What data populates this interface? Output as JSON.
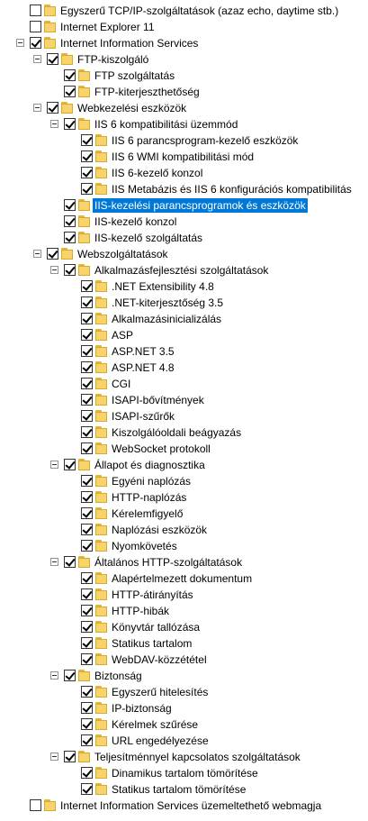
{
  "tree": {
    "items": [
      {
        "label": "Egyszerű TCP/IP-szolgáltatások (azaz echo, daytime stb.)",
        "level": 0,
        "checked": false,
        "expander": false
      },
      {
        "label": "Internet Explorer 11",
        "level": 0,
        "checked": false,
        "expander": false
      },
      {
        "label": "Internet Information Services",
        "level": 0,
        "checked": true,
        "expander": true
      },
      {
        "label": "FTP-kiszolgáló",
        "level": 1,
        "checked": true,
        "expander": true
      },
      {
        "label": "FTP szolgáltatás",
        "level": 2,
        "checked": true,
        "expander": false
      },
      {
        "label": "FTP-kiterjeszthetőség",
        "level": 2,
        "checked": true,
        "expander": false
      },
      {
        "label": "Webkezelési eszközök",
        "level": 1,
        "checked": true,
        "expander": true
      },
      {
        "label": "IIS 6 kompatibilitási üzemmód",
        "level": 2,
        "checked": true,
        "expander": true
      },
      {
        "label": "IIS 6 parancsprogram-kezelő eszközök",
        "level": 3,
        "checked": true,
        "expander": false
      },
      {
        "label": "IIS 6 WMI kompatibilitási mód",
        "level": 3,
        "checked": true,
        "expander": false
      },
      {
        "label": "IIS 6-kezelő konzol",
        "level": 3,
        "checked": true,
        "expander": false
      },
      {
        "label": "IIS Metabázis és IIS 6 konfigurációs kompatibilitás",
        "level": 3,
        "checked": true,
        "expander": false
      },
      {
        "label": "IIS-kezelési parancsprogramok és eszközök",
        "level": 2,
        "checked": true,
        "expander": false,
        "selected": true
      },
      {
        "label": "IIS-kezelő konzol",
        "level": 2,
        "checked": true,
        "expander": false
      },
      {
        "label": "IIS-kezelő szolgáltatás",
        "level": 2,
        "checked": true,
        "expander": false
      },
      {
        "label": "Webszolgáltatások",
        "level": 1,
        "checked": true,
        "expander": true
      },
      {
        "label": "Alkalmazásfejlesztési szolgáltatások",
        "level": 2,
        "checked": true,
        "expander": true
      },
      {
        "label": ".NET Extensibility 4.8",
        "level": 3,
        "checked": true,
        "expander": false
      },
      {
        "label": ".NET-kiterjesztőség 3.5",
        "level": 3,
        "checked": true,
        "expander": false
      },
      {
        "label": "Alkalmazásinicializálás",
        "level": 3,
        "checked": true,
        "expander": false
      },
      {
        "label": "ASP",
        "level": 3,
        "checked": true,
        "expander": false
      },
      {
        "label": "ASP.NET 3.5",
        "level": 3,
        "checked": true,
        "expander": false
      },
      {
        "label": "ASP.NET 4.8",
        "level": 3,
        "checked": true,
        "expander": false
      },
      {
        "label": "CGI",
        "level": 3,
        "checked": true,
        "expander": false
      },
      {
        "label": "ISAPI-bővítmények",
        "level": 3,
        "checked": true,
        "expander": false
      },
      {
        "label": "ISAPI-szűrők",
        "level": 3,
        "checked": true,
        "expander": false
      },
      {
        "label": "Kiszolgálóoldali beágyazás",
        "level": 3,
        "checked": true,
        "expander": false
      },
      {
        "label": "WebSocket protokoll",
        "level": 3,
        "checked": true,
        "expander": false
      },
      {
        "label": "Állapot és diagnosztika",
        "level": 2,
        "checked": true,
        "expander": true
      },
      {
        "label": "Egyéni naplózás",
        "level": 3,
        "checked": true,
        "expander": false
      },
      {
        "label": "HTTP-naplózás",
        "level": 3,
        "checked": true,
        "expander": false
      },
      {
        "label": "Kérelemfigyelő",
        "level": 3,
        "checked": true,
        "expander": false
      },
      {
        "label": "Naplózási eszközök",
        "level": 3,
        "checked": true,
        "expander": false
      },
      {
        "label": "Nyomkövetés",
        "level": 3,
        "checked": true,
        "expander": false
      },
      {
        "label": "Általános HTTP-szolgáltatások",
        "level": 2,
        "checked": true,
        "expander": true
      },
      {
        "label": "Alapértelmezett dokumentum",
        "level": 3,
        "checked": true,
        "expander": false
      },
      {
        "label": "HTTP-átirányítás",
        "level": 3,
        "checked": true,
        "expander": false
      },
      {
        "label": "HTTP-hibák",
        "level": 3,
        "checked": true,
        "expander": false
      },
      {
        "label": "Könyvtár tallózása",
        "level": 3,
        "checked": true,
        "expander": false
      },
      {
        "label": "Statikus tartalom",
        "level": 3,
        "checked": true,
        "expander": false
      },
      {
        "label": "WebDAV-közzététel",
        "level": 3,
        "checked": true,
        "expander": false
      },
      {
        "label": "Biztonság",
        "level": 2,
        "checked": true,
        "expander": true
      },
      {
        "label": "Egyszerű hitelesítés",
        "level": 3,
        "checked": true,
        "expander": false
      },
      {
        "label": "IP-biztonság",
        "level": 3,
        "checked": true,
        "expander": false
      },
      {
        "label": "Kérelmek szűrése",
        "level": 3,
        "checked": true,
        "expander": false
      },
      {
        "label": "URL engedélyezése",
        "level": 3,
        "checked": true,
        "expander": false
      },
      {
        "label": "Teljesítménnyel kapcsolatos szolgáltatások",
        "level": 2,
        "checked": true,
        "expander": true
      },
      {
        "label": "Dinamikus tartalom tömörítése",
        "level": 3,
        "checked": true,
        "expander": false
      },
      {
        "label": "Statikus tartalom tömörítése",
        "level": 3,
        "checked": true,
        "expander": false
      },
      {
        "label": "Internet Information Services üzemeltethető webmagja",
        "level": 0,
        "checked": false,
        "expander": false
      }
    ]
  },
  "colors": {
    "selection": "#0078d7",
    "folder": "#f6d46b"
  }
}
